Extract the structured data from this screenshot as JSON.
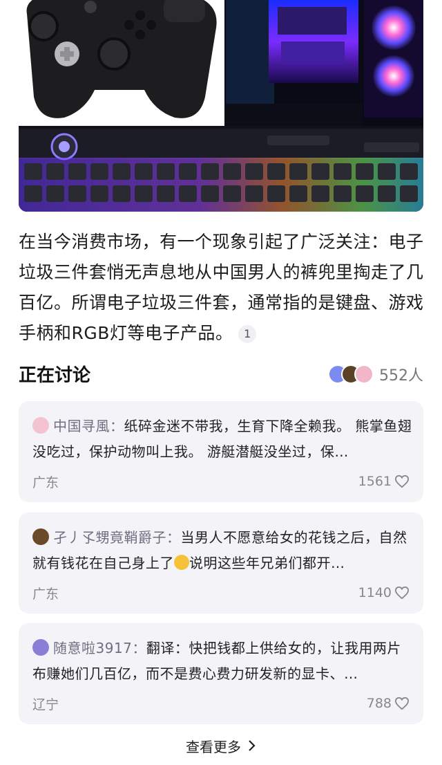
{
  "article": {
    "paragraph": "在当今消费市场，有一个现象引起了广泛关注：电子垃圾三件套悄无声息地从中国男人的裤兜里掏走了几百亿。所谓电子垃圾三件套，通常指的是键盘、游戏手柄和RGB灯等电子产品。",
    "citation": "1"
  },
  "discussion": {
    "title": "正在讨论",
    "participants": "552人"
  },
  "comments": [
    {
      "user": "中国寻風：",
      "text": "纸碎金迷不带我，生育下降全赖我。 熊掌鱼翅没吃过，保护动物叫上我。 游艇潜艇没坐过，保护海洋叫上我。",
      "text_display": "纸碎金迷不带我，生育下降全赖我。 熊掌鱼翅没吃过，保护动物叫上我。 游艇潜艇没坐过，保…",
      "location": "广东",
      "likes": "1561",
      "avatar_color": "#f3a7b8"
    },
    {
      "user": "孑丿孓甥竟鞘爵子：",
      "text_a": "当男人不愿意给女的花钱之后，自然就有钱花在自己身上了",
      "text_b": "说明这些年兄弟们都开…",
      "location": "广东",
      "likes": "1140",
      "avatar_color": "#6b4a2a"
    },
    {
      "user": "随意啦3917：",
      "text_display": "翻译：快把钱都上供给女的，让我用两片布赚她们几百亿，而不是费心费力研发新的显卡、…",
      "location": "辽宁",
      "likes": "788",
      "avatar_color": "#8a7fd6"
    }
  ],
  "see_more": "查看更多",
  "icons": {
    "like": "heart-outline-icon",
    "chevron": "chevron-right-icon",
    "hero_image": "gaming-setup-photo"
  }
}
